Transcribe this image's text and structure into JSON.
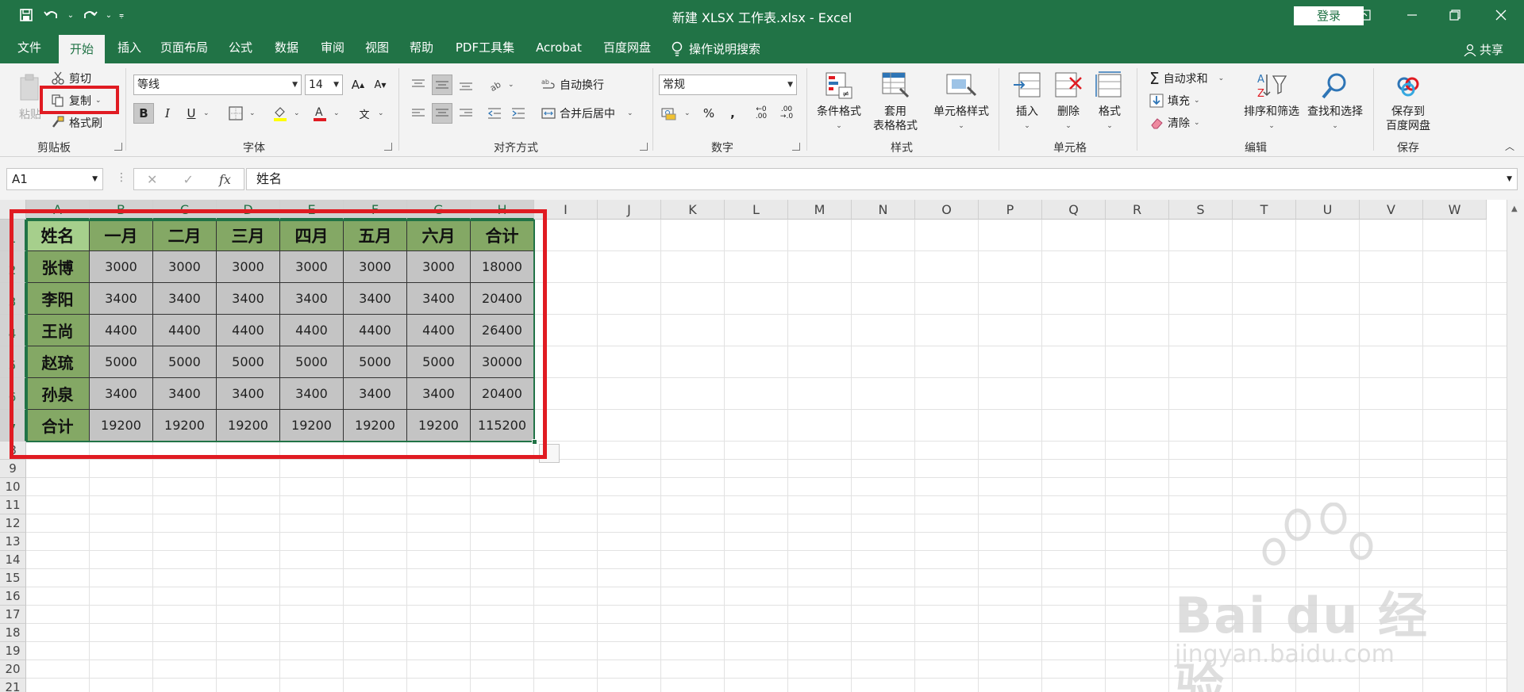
{
  "window": {
    "title": "新建 XLSX 工作表.xlsx  -  Excel",
    "login_label": "登录"
  },
  "tabs": [
    "文件",
    "开始",
    "插入",
    "页面布局",
    "公式",
    "数据",
    "审阅",
    "视图",
    "帮助",
    "PDF工具集",
    "Acrobat",
    "百度网盘",
    "操作说明搜索"
  ],
  "active_tab": "开始",
  "share_label": "共享",
  "ribbon": {
    "clipboard": {
      "paste": "粘贴",
      "cut": "剪切",
      "copy": "复制",
      "format_painter": "格式刷",
      "label": "剪贴板"
    },
    "font": {
      "name": "等线",
      "size": "14",
      "label": "字体"
    },
    "alignment": {
      "wrap": "自动换行",
      "merge": "合并后居中",
      "label": "对齐方式"
    },
    "number": {
      "format": "常规",
      "label": "数字"
    },
    "styles": {
      "conditional": "条件格式",
      "table_format_1": "套用",
      "table_format_2": "表格格式",
      "cell_styles": "单元格样式",
      "label": "样式"
    },
    "cells": {
      "insert": "插入",
      "delete": "删除",
      "format": "格式",
      "label": "单元格"
    },
    "editing": {
      "autosum": "自动求和",
      "fill": "填充",
      "clear": "清除",
      "sort": "排序和筛选",
      "find": "查找和选择",
      "label": "编辑"
    },
    "save": {
      "save_1": "保存到",
      "save_2": "百度网盘",
      "label": "保存"
    }
  },
  "formula_bar": {
    "name_box": "A1",
    "fx": "fx",
    "content": "姓名"
  },
  "columns": [
    "A",
    "B",
    "C",
    "D",
    "E",
    "F",
    "G",
    "H",
    "I",
    "J",
    "K",
    "L",
    "M",
    "N",
    "O",
    "P",
    "Q",
    "R",
    "S",
    "T",
    "U",
    "V",
    "W"
  ],
  "rows": [
    "1",
    "2",
    "3",
    "4",
    "5",
    "6",
    "7",
    "8",
    "9",
    "10",
    "11",
    "12",
    "13",
    "14",
    "15",
    "16",
    "17",
    "18",
    "19",
    "20",
    "21"
  ],
  "table": {
    "header": [
      "姓名",
      "一月",
      "二月",
      "三月",
      "四月",
      "五月",
      "六月",
      "合计"
    ],
    "rows": [
      [
        "张博",
        "3000",
        "3000",
        "3000",
        "3000",
        "3000",
        "3000",
        "18000"
      ],
      [
        "李阳",
        "3400",
        "3400",
        "3400",
        "3400",
        "3400",
        "3400",
        "20400"
      ],
      [
        "王尚",
        "4400",
        "4400",
        "4400",
        "4400",
        "4400",
        "4400",
        "26400"
      ],
      [
        "赵琉",
        "5000",
        "5000",
        "5000",
        "5000",
        "5000",
        "5000",
        "30000"
      ],
      [
        "孙泉",
        "3400",
        "3400",
        "3400",
        "3400",
        "3400",
        "3400",
        "20400"
      ],
      [
        "合计",
        "19200",
        "19200",
        "19200",
        "19200",
        "19200",
        "19200",
        "115200"
      ]
    ]
  },
  "watermark": {
    "brand": "Bai du 经验",
    "url": "jingyan.baidu.com"
  },
  "colors": {
    "excel_green": "#217346",
    "header_fill": "#84a865",
    "cell_fill": "#c4c4c4",
    "highlight_red": "#e01b22"
  }
}
